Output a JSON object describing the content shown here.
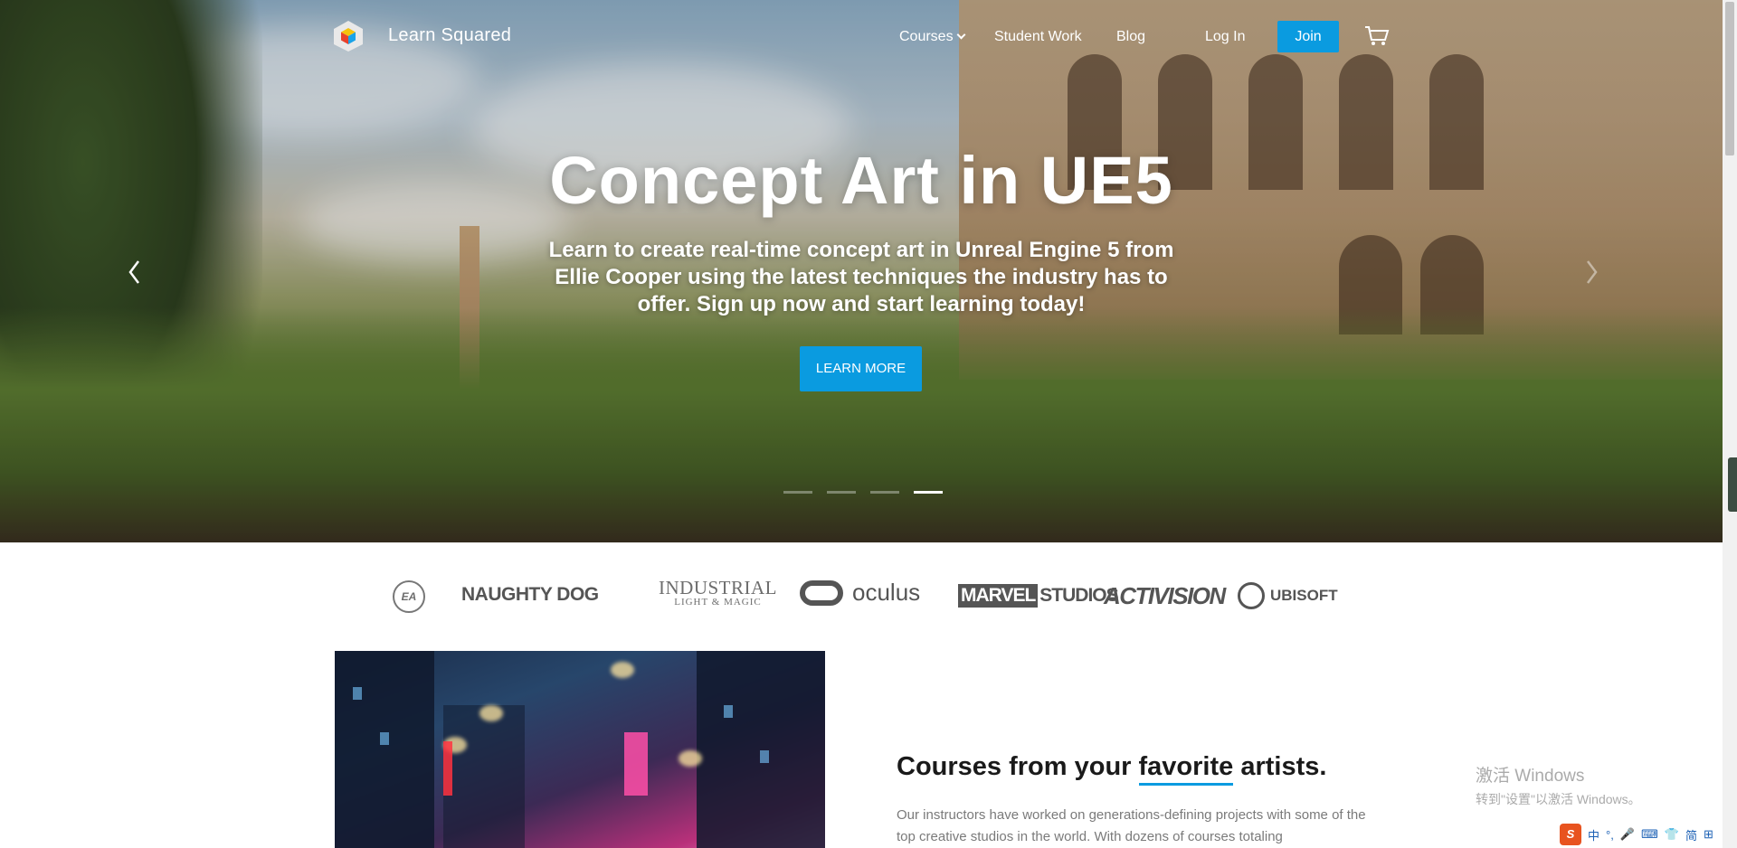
{
  "brand": {
    "name": "Learn Squared"
  },
  "nav": {
    "courses": "Courses",
    "student_work": "Student Work",
    "blog": "Blog",
    "login": "Log In",
    "join": "Join"
  },
  "hero": {
    "title": "Concept Art in UE5",
    "subtitle": "Learn to create real-time concept art in Unreal Engine 5 from Ellie Cooper using the latest techniques the industry has to offer. Sign up now and start learning today!",
    "cta": "LEARN MORE",
    "prev_glyph": "‹",
    "next_glyph": "›",
    "slide_count": 4,
    "active_slide": 4
  },
  "studios": {
    "ea": "EA",
    "naughty_dog": "NAUGHTY DOG",
    "ilm_line1": "INDUSTRIAL",
    "ilm_line2": "LIGHT & MAGIC",
    "oculus": "oculus",
    "marvel_a": "MARVEL",
    "marvel_b": "STUDIOS",
    "activision": "ACTIVISION",
    "ubisoft": "UBISOFT"
  },
  "feature": {
    "title_before": "Courses from your ",
    "title_highlight": "favorite",
    "title_after": " artists.",
    "text": "Our instructors have worked on generations-defining projects with some of the top creative studios in the world. With dozens of courses totaling"
  },
  "system": {
    "activate_title": "激活 Windows",
    "activate_sub": "转到\"设置\"以激活 Windows。",
    "ime_logo": "S",
    "ime_items": [
      "中",
      "°,",
      "🎤",
      "⌨",
      "👕",
      "简",
      "⊞"
    ]
  },
  "colors": {
    "accent": "#0a9be0",
    "text_dark": "#1a1a1a",
    "text_muted": "#7a7a7a"
  }
}
